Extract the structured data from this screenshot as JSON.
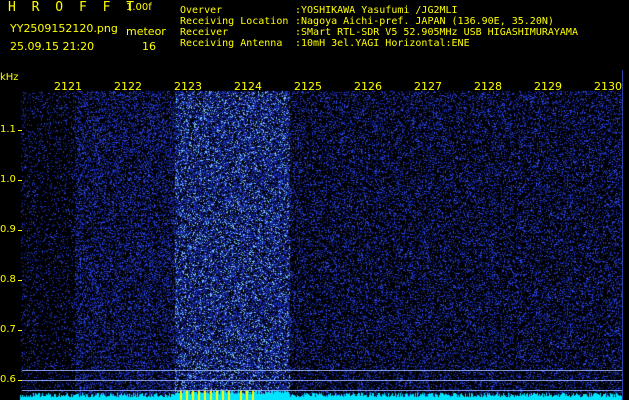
{
  "header": {
    "title": "H R O F F T",
    "version": "1.00f",
    "filename": "YY2509152120.png",
    "meteor_label": "meteor",
    "timestamp": "25.09.15 21:20",
    "meteor_count": "16",
    "info": [
      {
        "key": "Overver",
        "value": ":YOSHIKAWA Yasufumi /JG2MLI"
      },
      {
        "key": "Receiving Location",
        "value": ":Nagoya Aichi-pref. JAPAN (136.90E, 35.20N)"
      },
      {
        "key": "Receiver",
        "value": ":SMart RTL-SDR V5 52.905MHz USB HIGASHIMURAYAMA"
      },
      {
        "key": "Receiving Antenna",
        "value": ":10mH 3el.YAGI Horizontal:ENE"
      }
    ]
  },
  "waterfall": {
    "unit_label": "kHz",
    "time_labels": [
      "2121",
      "2122",
      "2123",
      "2124",
      "2125",
      "2126",
      "2127",
      "2128",
      "2129",
      "2130"
    ],
    "freq_labels": [
      "1.1",
      "1.0",
      "0.9",
      "0.8",
      "0.7",
      "0.6"
    ],
    "colors": {
      "label": "#ffff00",
      "noise": "#1a2aa0",
      "baseline": "#00e5ff"
    }
  }
}
